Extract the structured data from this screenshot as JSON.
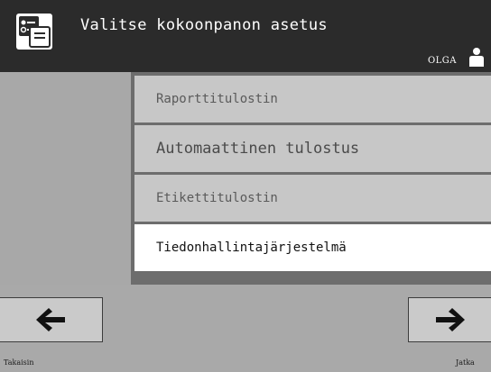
{
  "header": {
    "title": "Valitse kokoonpanon asetus",
    "icon": "settings-printer-icon",
    "user": "OLGA",
    "user_icon": "user-icon"
  },
  "options": [
    {
      "label": "Raporttitulostin",
      "selected": false
    },
    {
      "label": "Automaattinen tulostus",
      "selected": false
    },
    {
      "label": "Etikettitulostin",
      "selected": false
    },
    {
      "label": "Tiedonhallintajärjestelmä",
      "selected": true
    }
  ],
  "nav": {
    "back_label": "Takaisin",
    "back_icon": "arrow-left-icon",
    "next_label": "Jatka",
    "next_icon": "arrow-right-icon"
  },
  "colors": {
    "header_bg": "#2b2b2b",
    "background": "#a9a9a9",
    "item_bg": "#c7c7c7",
    "selected_bg": "#ffffff"
  }
}
